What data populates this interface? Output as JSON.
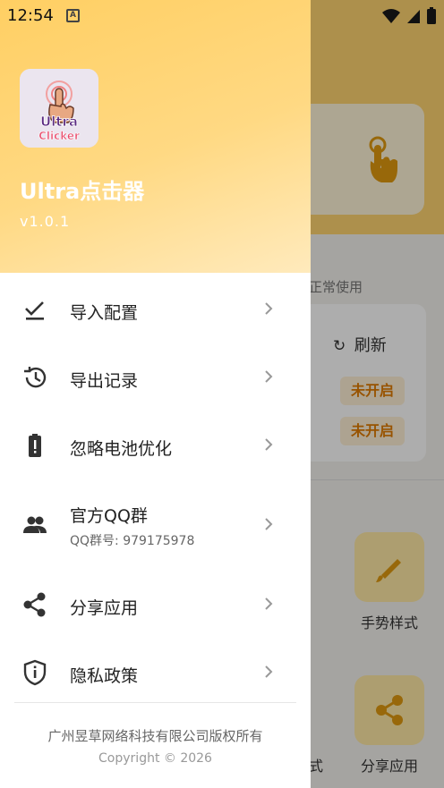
{
  "status_bar": {
    "time": "12:54",
    "notification_icon": "a-icon",
    "icons": [
      "wifi-icon",
      "signal-icon",
      "battery-icon"
    ]
  },
  "drawer": {
    "app_name": "Ultra点击器",
    "version": "v1.0.1",
    "logo_text_line1": "Ultra",
    "logo_text_line2": "Clicker",
    "menu": [
      {
        "label": "导入配置",
        "icon": "import-check-icon"
      },
      {
        "label": "导出记录",
        "icon": "history-icon"
      },
      {
        "label": "忽略电池优化",
        "icon": "battery-alert-icon"
      },
      {
        "label": "官方QQ群",
        "sublabel": "QQ群号: 979175978",
        "icon": "group-icon"
      },
      {
        "label": "分享应用",
        "icon": "share-icon"
      },
      {
        "label": "隐私政策",
        "icon": "privacy-shield-icon"
      }
    ],
    "footer_company": "广州昱草网络科技有限公司版权所有",
    "footer_copyright": "Copyright © 2026"
  },
  "background": {
    "status_text": "正常使用",
    "refresh_label": "刷新",
    "badge_1": "未开启",
    "badge_2": "未开启",
    "tile_1_label": "手势样式",
    "tile_2_label": "分享应用",
    "partial_label": "式"
  },
  "colors": {
    "accent": "#ffcf63",
    "badge_text": "#e07b00",
    "badge_bg": "#fff0d6"
  }
}
